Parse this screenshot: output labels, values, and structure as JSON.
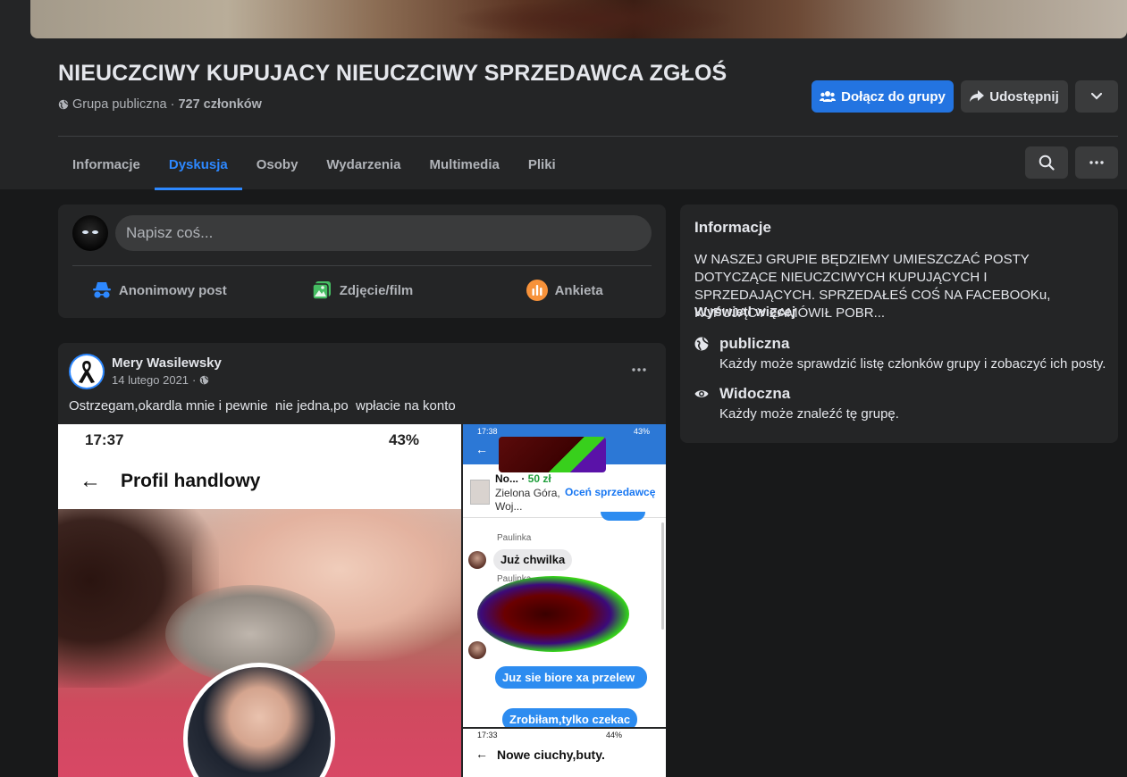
{
  "group": {
    "title": "NIEUCZCIWY KUPUJACY NIEUCZCIWY SPRZEDAWCA ZGŁOŚ",
    "privacy": "Grupa publiczna",
    "separator": "·",
    "members": "727 członków",
    "join_label": "Dołącz do grupy",
    "share_label": "Udostępnij",
    "more_icon": "chevron-down-icon"
  },
  "tabs": [
    "Informacje",
    "Dyskusja",
    "Osoby",
    "Wydarzenia",
    "Multimedia",
    "Pliki"
  ],
  "active_tab": "Dyskusja",
  "composer": {
    "placeholder": "Napisz coś...",
    "actions": [
      {
        "label": "Anonimowy post",
        "icon": "anonymous-icon",
        "color": "#2d88ff"
      },
      {
        "label": "Zdjęcie/film",
        "icon": "photo-icon",
        "color": "#45bd62"
      },
      {
        "label": "Ankieta",
        "icon": "poll-icon",
        "color": "#f7b928"
      }
    ]
  },
  "post": {
    "author": "Mery Wasilewsky",
    "date": "14 lutego 2021",
    "dot": "·",
    "text": "Ostrzegam,okardla mnie i pewnie  nie jedna,po  wpłacie na konto",
    "photo_left": {
      "time": "17:37",
      "battery": "43%",
      "title": "Profil handlowy"
    },
    "photo_right_top": {
      "time": "17:38",
      "battery": "43%",
      "product_name": "No...",
      "price": "50 zł",
      "location": "Zielona Góra, Woj...",
      "rate_label": "Oceń sprzedawcę",
      "sender": "Paulinka",
      "msg1": "Już chwilka",
      "sender2": "Paulinka",
      "msg2": "Juz sie biore xa przelew",
      "msg3": "Zrobiłam,tylko czekac"
    },
    "photo_right_bottom": {
      "time": "17:33",
      "battery": "44%",
      "title": "Nowe ciuchy,buty."
    }
  },
  "info": {
    "title": "Informacje",
    "description": "W NASZEJ GRUPIE BĘDZIEMY UMIESZCZAĆ POSTY DOTYCZĄCE NIEUCZCIWYCH KUPUJĄCYCH I SPRZEDAJĄCYCH. SPRZEDAŁEŚ COŚ NA FACEBOOKu, KUPUJĄCY ZAMÓWIŁ POBR...",
    "see_more": "Wyświetl więcej",
    "items": [
      {
        "label": "publiczna",
        "sub": "Każdy może sprawdzić listę członków grupy i zobaczyć ich posty.",
        "icon": "globe-icon"
      },
      {
        "label": "Widoczna",
        "sub": "Każdy może znaleźć tę grupę.",
        "icon": "eye-icon"
      }
    ]
  },
  "colors": {
    "accent": "#2d88ff",
    "join_button": "#2374e1",
    "background": "#18191a",
    "card": "#242526"
  }
}
